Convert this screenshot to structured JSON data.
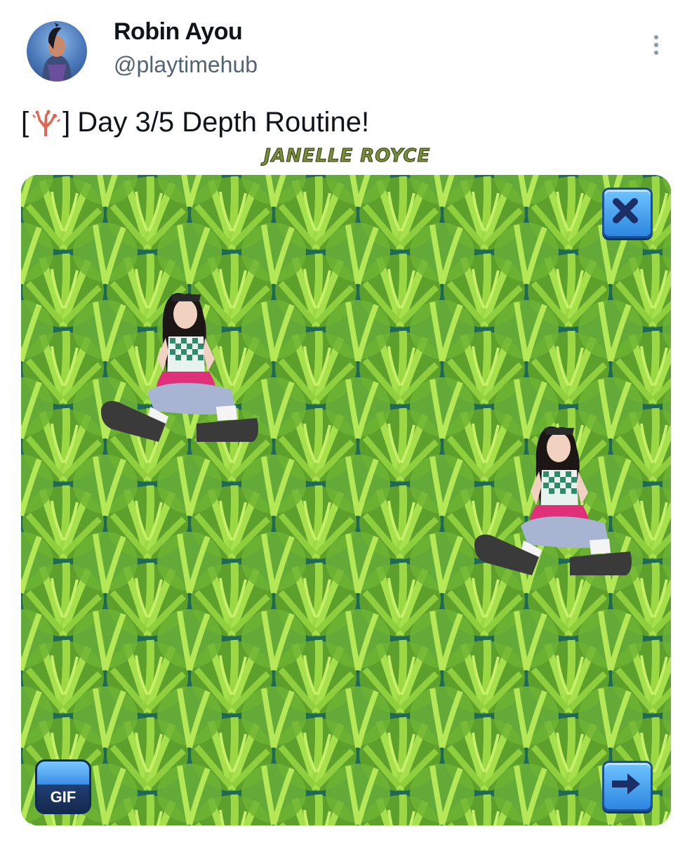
{
  "author": {
    "name": "Robin Ayou",
    "handle": "@playtimehub"
  },
  "tweet": {
    "bracket_open": "[",
    "bracket_close": "]",
    "text": "Day 3/5 Depth Routine!",
    "emoji_icon": "coral-icon"
  },
  "media": {
    "watermark": "JANELLE ROYCE",
    "gif_label": "GIF",
    "close_icon": "close-icon",
    "next_icon": "arrow-right-icon"
  },
  "colors": {
    "kelp": "#7cc83a",
    "water": "#1f6a55",
    "button_blue": "#3b8fe6",
    "text_primary": "#0f1419",
    "text_secondary": "#536471"
  }
}
